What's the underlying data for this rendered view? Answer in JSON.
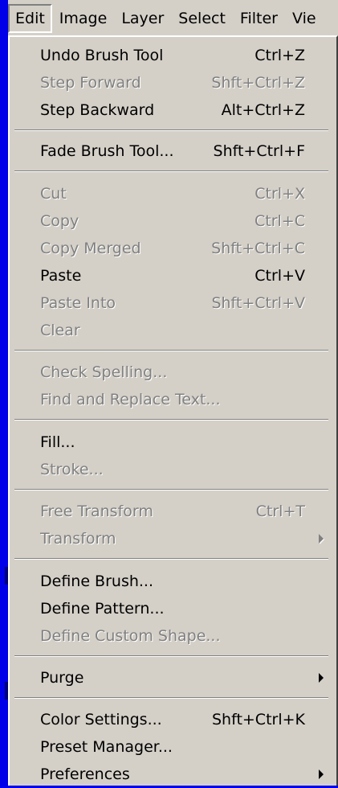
{
  "menubar": {
    "items": [
      "Edit",
      "Image",
      "Layer",
      "Select",
      "Filter",
      "Vie"
    ]
  },
  "menu": {
    "items": [
      {
        "label": "Undo Brush Tool",
        "accel": "Ctrl+Z",
        "enabled": true
      },
      {
        "label": "Step Forward",
        "accel": "Shft+Ctrl+Z",
        "enabled": false
      },
      {
        "label": "Step Backward",
        "accel": "Alt+Ctrl+Z",
        "enabled": true
      },
      {
        "label": "Fade Brush Tool...",
        "accel": "Shft+Ctrl+F",
        "enabled": true
      },
      {
        "label": "Cut",
        "accel": "Ctrl+X",
        "enabled": false
      },
      {
        "label": "Copy",
        "accel": "Ctrl+C",
        "enabled": false
      },
      {
        "label": "Copy Merged",
        "accel": "Shft+Ctrl+C",
        "enabled": false
      },
      {
        "label": "Paste",
        "accel": "Ctrl+V",
        "enabled": true
      },
      {
        "label": "Paste Into",
        "accel": "Shft+Ctrl+V",
        "enabled": false
      },
      {
        "label": "Clear",
        "accel": "",
        "enabled": false
      },
      {
        "label": "Check Spelling...",
        "accel": "",
        "enabled": false
      },
      {
        "label": "Find and Replace Text...",
        "accel": "",
        "enabled": false
      },
      {
        "label": "Fill...",
        "accel": "",
        "enabled": true
      },
      {
        "label": "Stroke...",
        "accel": "",
        "enabled": false
      },
      {
        "label": "Free Transform",
        "accel": "Ctrl+T",
        "enabled": false
      },
      {
        "label": "Transform",
        "accel": "",
        "enabled": false,
        "submenu": true
      },
      {
        "label": "Define Brush...",
        "accel": "",
        "enabled": true
      },
      {
        "label": "Define Pattern...",
        "accel": "",
        "enabled": true
      },
      {
        "label": "Define Custom Shape...",
        "accel": "",
        "enabled": false
      },
      {
        "label": "Purge",
        "accel": "",
        "enabled": true,
        "submenu": true
      },
      {
        "label": "Color Settings...",
        "accel": "Shft+Ctrl+K",
        "enabled": true
      },
      {
        "label": "Preset Manager...",
        "accel": "",
        "enabled": true
      },
      {
        "label": "Preferences",
        "accel": "",
        "enabled": true,
        "submenu": true
      }
    ]
  },
  "colors": {
    "desktop": "#0000f0",
    "menu_bg": "#d4d0c8",
    "disabled_text": "#808080"
  }
}
